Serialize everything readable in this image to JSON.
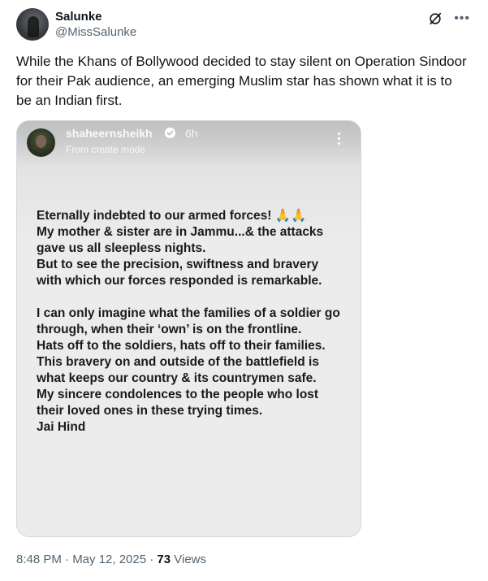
{
  "author": {
    "display_name": "Salunke",
    "handle": "@MissSalunke",
    "avatar_icon": "profile-avatar",
    "grok_icon": "slashed-circle-icon",
    "more_icon": "ellipsis-icon"
  },
  "tweet": {
    "text": "While the Khans of Bollywood decided to stay silent on Operation Sindoor for their Pak audience, an emerging Muslim star has shown what it is to be an Indian first."
  },
  "story": {
    "username": "shaheernsheikh",
    "time": "6h",
    "mode": "From create mode",
    "verified_icon": "verified-badge-icon",
    "menu_icon": "vertical-ellipsis-icon",
    "body": "Eternally indebted to our armed forces! 🙏🙏\nMy mother & sister are in Jammu...& the attacks gave us all sleepless nights.\nBut to see the precision, swiftness and bravery with which our forces responded is remarkable.\n\nI can only imagine what the families of a soldier go through, when their ‘own’ is on the frontline.\nHats off to the soldiers, hats off to their families.\nThis bravery on and outside of the battlefield is what keeps our country & its countrymen safe.\nMy sincere condolences to the people who lost their loved ones in these trying times.\nJai Hind"
  },
  "meta": {
    "timestamp": "8:48 PM · May 12, 2025 · ",
    "views_count": "73",
    "views_label": " Views"
  }
}
